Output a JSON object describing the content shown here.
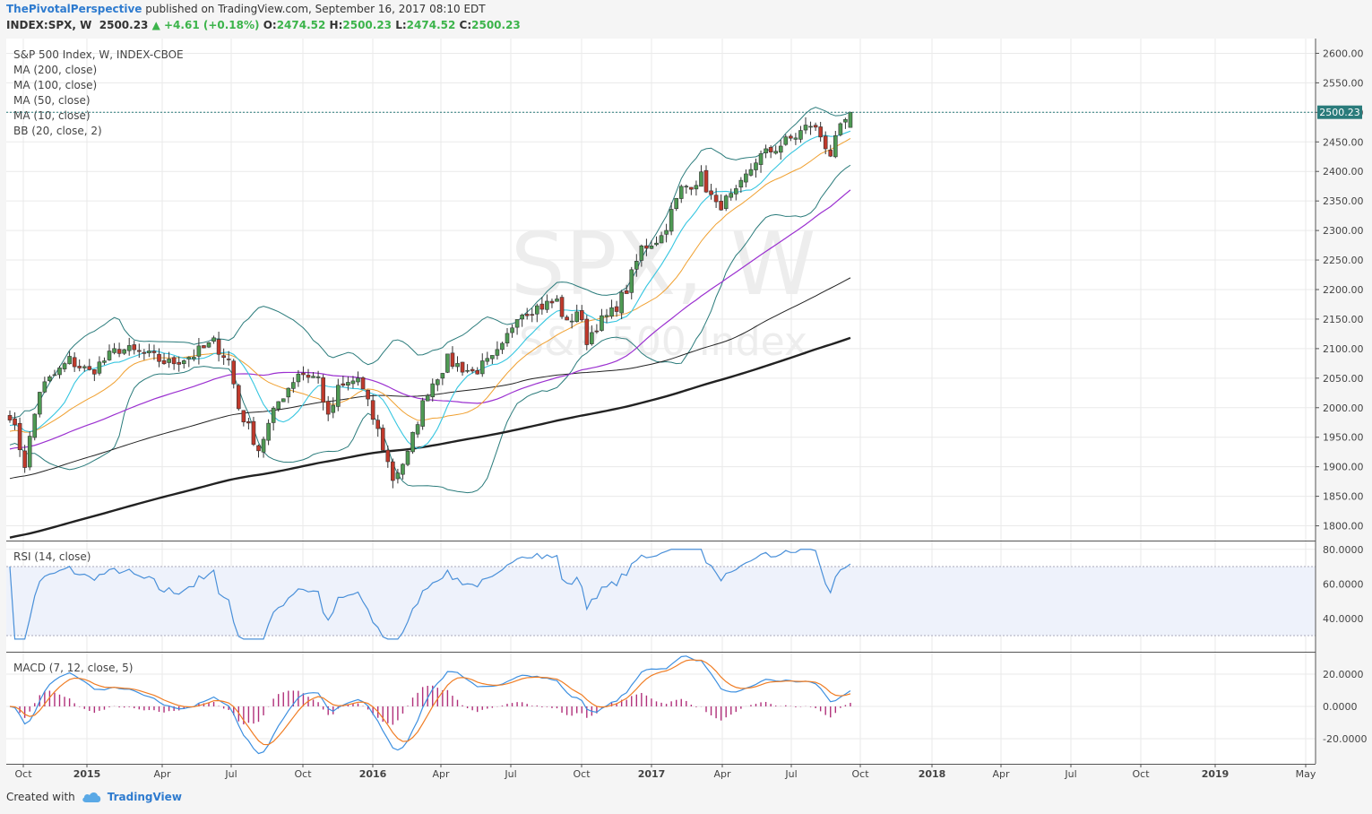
{
  "header": {
    "author": "ThePivotalPerspective",
    "published": "published on TradingView.com, September 16, 2017 08:10 EDT",
    "symbol": "INDEX:SPX, W",
    "last": "2500.23",
    "change": "▲ +4.61 (+0.18%)",
    "ohlc_o_label": "O:",
    "ohlc_o": "2474.52",
    "ohlc_h_label": "H:",
    "ohlc_h": "2500.23",
    "ohlc_l_label": "L:",
    "ohlc_l": "2474.52",
    "ohlc_c_label": "C:",
    "ohlc_c": "2500.23"
  },
  "watermark": {
    "ticker": "SPX, W",
    "name": "S&P 500 Index"
  },
  "legend": [
    "S&P 500 Index, W, INDEX-CBOE",
    "MA (200, close)",
    "MA (100, close)",
    "MA (50, close)",
    "MA (10, close)",
    "BB (20, close, 2)"
  ],
  "rsi_label": "RSI (14, close)",
  "macd_label": "MACD (7, 12, close, 5)",
  "footer": {
    "created": "Created with",
    "brand": "TradingView"
  },
  "colors": {
    "up": "#4e9a53",
    "down": "#c0392b",
    "bb": "#2a7b7b",
    "ma10": "#36c6e0",
    "ma50": "#f0a030",
    "ma100": "#9b30d0",
    "ma200": "#222222",
    "rsi": "#4a90d9",
    "macd": "#3c8fe0",
    "signal": "#f07d24",
    "hist": "#b0307a",
    "price_label_bg": "#2a7b7b"
  },
  "chart_data": {
    "type": "candlestick",
    "price_axis": {
      "ticks": [
        1800,
        1850,
        1900,
        1950,
        2000,
        2050,
        2100,
        2150,
        2200,
        2250,
        2300,
        2350,
        2400,
        2450,
        2500,
        2550,
        2600
      ],
      "labels": [
        "1800.00",
        "1850.00",
        "1900.00",
        "1950.00",
        "2000.00",
        "2050.00",
        "2100.00",
        "2150.00",
        "2200.00",
        "2250.00",
        "2300.00",
        "2350.00",
        "2400.00",
        "2450.00",
        "2500.00",
        "2550.00",
        "2600.00"
      ],
      "ylim": [
        1775,
        2625
      ]
    },
    "last_price": 2500.23,
    "last_price_label": "2500.23",
    "time_axis": {
      "labels": [
        "Oct",
        "2015",
        "Apr",
        "Jul",
        "Oct",
        "2016",
        "Apr",
        "Jul",
        "Oct",
        "2017",
        "Apr",
        "Jul",
        "Oct",
        "2018",
        "Apr",
        "Jul",
        "Oct",
        "2019",
        "May"
      ],
      "bold": [
        false,
        true,
        false,
        false,
        false,
        true,
        false,
        false,
        false,
        true,
        false,
        false,
        false,
        true,
        false,
        false,
        false,
        true,
        false
      ]
    },
    "close_anchors": [
      [
        0,
        1990
      ],
      [
        3,
        1905
      ],
      [
        6,
        2030
      ],
      [
        12,
        2080
      ],
      [
        16,
        2060
      ],
      [
        22,
        2100
      ],
      [
        27,
        2090
      ],
      [
        32,
        2075
      ],
      [
        37,
        2090
      ],
      [
        41,
        2110
      ],
      [
        44,
        2080
      ],
      [
        46,
        2000
      ],
      [
        50,
        1930
      ],
      [
        54,
        2010
      ],
      [
        58,
        2060
      ],
      [
        62,
        2050
      ],
      [
        64,
        1980
      ],
      [
        66,
        2030
      ],
      [
        70,
        2050
      ],
      [
        74,
        1960
      ],
      [
        77,
        1880
      ],
      [
        80,
        1920
      ],
      [
        82,
        1980
      ],
      [
        84,
        2030
      ],
      [
        88,
        2080
      ],
      [
        93,
        2060
      ],
      [
        97,
        2080
      ],
      [
        99,
        2100
      ],
      [
        102,
        2160
      ],
      [
        106,
        2170
      ],
      [
        110,
        2180
      ],
      [
        112,
        2140
      ],
      [
        114,
        2165
      ],
      [
        116,
        2115
      ],
      [
        118,
        2140
      ],
      [
        121,
        2160
      ],
      [
        124,
        2200
      ],
      [
        127,
        2270
      ],
      [
        131,
        2290
      ],
      [
        135,
        2370
      ],
      [
        139,
        2390
      ],
      [
        142,
        2340
      ],
      [
        146,
        2360
      ],
      [
        150,
        2420
      ],
      [
        154,
        2440
      ],
      [
        158,
        2460
      ],
      [
        161,
        2480
      ],
      [
        163,
        2460
      ],
      [
        165,
        2430
      ],
      [
        167,
        2470
      ],
      [
        169,
        2500.23
      ]
    ],
    "indicators": [
      "MA 200",
      "MA 100",
      "MA 50",
      "MA 10",
      "Bollinger Bands 20,2",
      "RSI 14",
      "MACD 7,12,5"
    ],
    "rsi_axis": {
      "labels": [
        "40.0000",
        "60.0000",
        "80.0000"
      ],
      "values": [
        40,
        60,
        80
      ],
      "band": [
        30,
        70
      ]
    },
    "macd_axis": {
      "labels": [
        "-20.0000",
        "0.0000",
        "20.0000"
      ],
      "values": [
        -20,
        0,
        20
      ]
    }
  }
}
